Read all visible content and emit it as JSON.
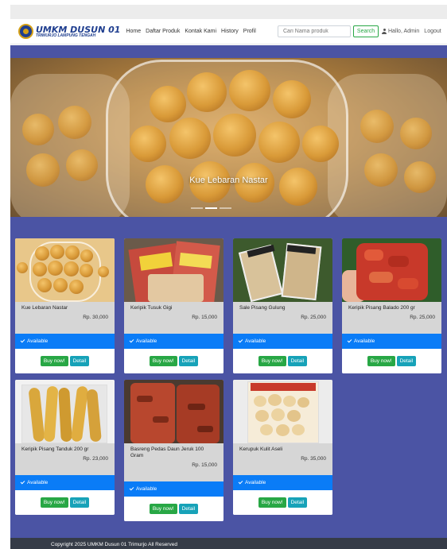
{
  "brand": {
    "title": "UMKM DUSUN 01",
    "subtitle": "TRIMURJO LAMPUNG TENGAH"
  },
  "nav": {
    "items": [
      "Home",
      "Daftar Produk",
      "Kontak Kami",
      "History",
      "Profil"
    ]
  },
  "search": {
    "placeholder": "Cari Nama produk",
    "button_label": "Search"
  },
  "user": {
    "greeting": "Hallo, Admin",
    "logout_label": "Logout"
  },
  "hero": {
    "caption": "Kue Lebaran Nastar",
    "slide_count": 3,
    "active_slide": 2
  },
  "products": [
    {
      "name": "Kue Lebaran Nastar",
      "price": "Rp. 30,000",
      "status": "Available",
      "buy_label": "Buy now!",
      "detail_label": "Detail"
    },
    {
      "name": "Keripik Tusuk Gigi",
      "price": "Rp. 15,000",
      "status": "Available",
      "buy_label": "Buy now!",
      "detail_label": "Detail"
    },
    {
      "name": "Sale Pisang Gulung",
      "price": "Rp. 25,000",
      "status": "Available",
      "buy_label": "Buy now!",
      "detail_label": "Detail"
    },
    {
      "name": "Keripik Pisang Balado 200 gr",
      "price": "Rp. 25,000",
      "status": "Available",
      "buy_label": "Buy now!",
      "detail_label": "Detail"
    },
    {
      "name": "Keripik Pisang Tanduk 200 gr",
      "price": "Rp. 23,000",
      "status": "Available",
      "buy_label": "Buy now!",
      "detail_label": "Detail"
    },
    {
      "name": "Basreng Pedas Daun Jeruk 100 Gram",
      "price": "Rp. 15,000",
      "status": "Available",
      "buy_label": "Buy now!",
      "detail_label": "Detail"
    },
    {
      "name": "Kerupuk Kulit Aseli",
      "price": "Rp. 35,000",
      "status": "Available",
      "buy_label": "Buy now!",
      "detail_label": "Detail"
    }
  ],
  "footer": {
    "text": "Copyright 2025 UMKM Dusun 01 Trimurjo All Reserved"
  }
}
